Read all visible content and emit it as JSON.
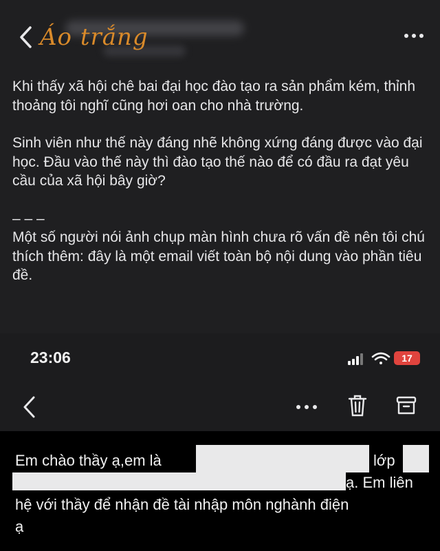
{
  "watermark": "Áo trắng",
  "post": {
    "paragraphs": [
      "Khi thấy xã hội chê bai đại học đào tạo ra sản phẩm kém, thỉnh thoảng tôi nghĩ cũng hơi oan cho nhà trường.",
      "Sinh viên như thế này đáng nhẽ không xứng đáng được vào đại học. Đầu vào thế này thì đào tạo thế nào để có đầu ra đạt yêu cầu của xã hội bây giờ?",
      "– – –",
      "Một số người nói ảnh chụp màn hình chưa rõ vấn đề nên tôi chú thích thêm: đây là một email viết toàn bộ nội dung vào phần tiêu đề."
    ]
  },
  "screenshot": {
    "time": "23:06",
    "battery": "17",
    "mail": {
      "line1a": "Em chào thầy ạ,em là",
      "line1b": "lớp",
      "line2": "ạ. Em liên",
      "line3": "hệ với thầy để nhận đề tài nhập môn nghành điện",
      "line4": "ạ"
    }
  },
  "icons": {
    "back": "chevron-left-icon",
    "more": "ellipsis-icon",
    "trash": "trash-icon",
    "archive": "archive-icon",
    "wifi": "wifi-icon",
    "signal": "cellular-signal-icon",
    "battery": "battery-charging-icon"
  },
  "colors": {
    "background": "#1f1f21",
    "watermark": "#d98a2a",
    "battery_low": "#e0443e",
    "mail_bg": "#000000"
  }
}
